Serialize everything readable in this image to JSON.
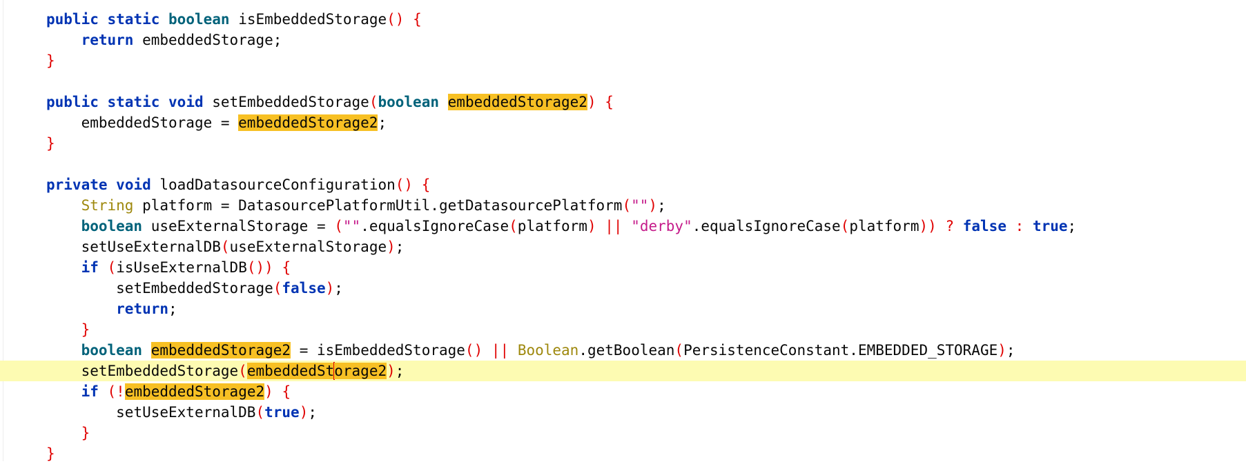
{
  "editor": {
    "lines": [
      {
        "segments": [
          {
            "t": "public",
            "c": "kw"
          },
          {
            "t": " "
          },
          {
            "t": "static",
            "c": "kw"
          },
          {
            "t": " "
          },
          {
            "t": "boolean",
            "c": "kw-type"
          },
          {
            "t": " isEmbeddedStorage"
          },
          {
            "t": "()",
            "c": "paren"
          },
          {
            "t": " "
          },
          {
            "t": "{",
            "c": "brace"
          }
        ],
        "indent": 0
      },
      {
        "segments": [
          {
            "t": "return",
            "c": "kw"
          },
          {
            "t": " embeddedStorage;"
          }
        ],
        "indent": 1
      },
      {
        "segments": [
          {
            "t": "}",
            "c": "brace"
          }
        ],
        "indent": 0
      },
      {
        "segments": [],
        "indent": 0
      },
      {
        "segments": [
          {
            "t": "public",
            "c": "kw"
          },
          {
            "t": " "
          },
          {
            "t": "static",
            "c": "kw"
          },
          {
            "t": " "
          },
          {
            "t": "void",
            "c": "kw"
          },
          {
            "t": " setEmbeddedStorage"
          },
          {
            "t": "(",
            "c": "paren"
          },
          {
            "t": "boolean",
            "c": "kw-type"
          },
          {
            "t": " "
          },
          {
            "t": "embeddedStorage2",
            "c": "hl"
          },
          {
            "t": ")",
            "c": "paren"
          },
          {
            "t": " "
          },
          {
            "t": "{",
            "c": "brace"
          }
        ],
        "indent": 0
      },
      {
        "segments": [
          {
            "t": "embeddedStorage = "
          },
          {
            "t": "embeddedStorage2",
            "c": "hl"
          },
          {
            "t": ";"
          }
        ],
        "indent": 1
      },
      {
        "segments": [
          {
            "t": "}",
            "c": "brace"
          }
        ],
        "indent": 0
      },
      {
        "segments": [],
        "indent": 0
      },
      {
        "segments": [
          {
            "t": "private",
            "c": "kw"
          },
          {
            "t": " "
          },
          {
            "t": "void",
            "c": "kw"
          },
          {
            "t": " loadDatasourceConfiguration"
          },
          {
            "t": "()",
            "c": "paren"
          },
          {
            "t": " "
          },
          {
            "t": "{",
            "c": "brace"
          }
        ],
        "indent": 0
      },
      {
        "segments": [
          {
            "t": "String",
            "c": "cls"
          },
          {
            "t": " platform = DatasourcePlatformUtil.getDatasourcePlatform"
          },
          {
            "t": "(",
            "c": "paren"
          },
          {
            "t": "\"\"",
            "c": "str-purple"
          },
          {
            "t": ")",
            "c": "paren"
          },
          {
            "t": ";"
          }
        ],
        "indent": 1
      },
      {
        "segments": [
          {
            "t": "boolean",
            "c": "kw-type"
          },
          {
            "t": " useExternalStorage = "
          },
          {
            "t": "(",
            "c": "paren"
          },
          {
            "t": "\"\"",
            "c": "str-purple"
          },
          {
            "t": ".equalsIgnoreCase"
          },
          {
            "t": "(",
            "c": "paren"
          },
          {
            "t": "platform"
          },
          {
            "t": ")",
            "c": "paren"
          },
          {
            "t": " "
          },
          {
            "t": "||",
            "c": "paren"
          },
          {
            "t": " "
          },
          {
            "t": "\"derby\"",
            "c": "str-purple"
          },
          {
            "t": ".equalsIgnoreCase"
          },
          {
            "t": "(",
            "c": "paren"
          },
          {
            "t": "platform"
          },
          {
            "t": "))",
            "c": "paren"
          },
          {
            "t": " "
          },
          {
            "t": "?",
            "c": "paren"
          },
          {
            "t": " "
          },
          {
            "t": "false",
            "c": "kw"
          },
          {
            "t": " "
          },
          {
            "t": ":",
            "c": "paren"
          },
          {
            "t": " "
          },
          {
            "t": "true",
            "c": "kw"
          },
          {
            "t": ";"
          }
        ],
        "indent": 1
      },
      {
        "segments": [
          {
            "t": "setUseExternalDB"
          },
          {
            "t": "(",
            "c": "paren"
          },
          {
            "t": "useExternalStorage"
          },
          {
            "t": ")",
            "c": "paren"
          },
          {
            "t": ";"
          }
        ],
        "indent": 1
      },
      {
        "segments": [
          {
            "t": "if",
            "c": "kw"
          },
          {
            "t": " "
          },
          {
            "t": "(",
            "c": "paren"
          },
          {
            "t": "isUseExternalDB"
          },
          {
            "t": "())",
            "c": "paren"
          },
          {
            "t": " "
          },
          {
            "t": "{",
            "c": "brace"
          }
        ],
        "indent": 1
      },
      {
        "segments": [
          {
            "t": "setEmbeddedStorage"
          },
          {
            "t": "(",
            "c": "paren"
          },
          {
            "t": "false",
            "c": "kw"
          },
          {
            "t": ")",
            "c": "paren"
          },
          {
            "t": ";"
          }
        ],
        "indent": 2
      },
      {
        "segments": [
          {
            "t": "return",
            "c": "kw"
          },
          {
            "t": ";"
          }
        ],
        "indent": 2
      },
      {
        "segments": [
          {
            "t": "}",
            "c": "brace"
          }
        ],
        "indent": 1
      },
      {
        "segments": [
          {
            "t": "boolean",
            "c": "kw-type"
          },
          {
            "t": " "
          },
          {
            "t": "embeddedStorage2",
            "c": "hl"
          },
          {
            "t": " = isEmbeddedStorage"
          },
          {
            "t": "()",
            "c": "paren"
          },
          {
            "t": " "
          },
          {
            "t": "||",
            "c": "paren"
          },
          {
            "t": " "
          },
          {
            "t": "Boolean",
            "c": "cls"
          },
          {
            "t": ".getBoolean"
          },
          {
            "t": "(",
            "c": "paren"
          },
          {
            "t": "PersistenceConstant.EMBEDDED_STORAGE"
          },
          {
            "t": ")",
            "c": "paren"
          },
          {
            "t": ";"
          }
        ],
        "indent": 1
      },
      {
        "segments": [
          {
            "t": "setEmbeddedStorage"
          },
          {
            "t": "(",
            "c": "paren"
          },
          {
            "t": "embeddedSt",
            "c": "hl"
          },
          {
            "t": "",
            "c": "caret"
          },
          {
            "t": "orage2",
            "c": "hl"
          },
          {
            "t": ")",
            "c": "paren"
          },
          {
            "t": ";"
          }
        ],
        "indent": 1,
        "current": true
      },
      {
        "segments": [
          {
            "t": "if",
            "c": "kw"
          },
          {
            "t": " "
          },
          {
            "t": "(!",
            "c": "paren"
          },
          {
            "t": "embeddedStorage2",
            "c": "hl"
          },
          {
            "t": ")",
            "c": "paren"
          },
          {
            "t": " "
          },
          {
            "t": "{",
            "c": "brace"
          }
        ],
        "indent": 1
      },
      {
        "segments": [
          {
            "t": "setUseExternalDB"
          },
          {
            "t": "(",
            "c": "paren"
          },
          {
            "t": "true",
            "c": "kw"
          },
          {
            "t": ")",
            "c": "paren"
          },
          {
            "t": ";"
          }
        ],
        "indent": 2
      },
      {
        "segments": [
          {
            "t": "}",
            "c": "brace"
          }
        ],
        "indent": 1
      },
      {
        "segments": [
          {
            "t": "}",
            "c": "brace"
          }
        ],
        "indent": 0
      }
    ],
    "indent_unit": "    "
  },
  "colors": {
    "keyword": "#0033b3",
    "type_keyword": "#00627a",
    "brace": "#e00000",
    "class_name": "#9e880d",
    "string": "#c51b8a",
    "highlight": "#f7c024",
    "current_line": "#fdfbb2"
  }
}
